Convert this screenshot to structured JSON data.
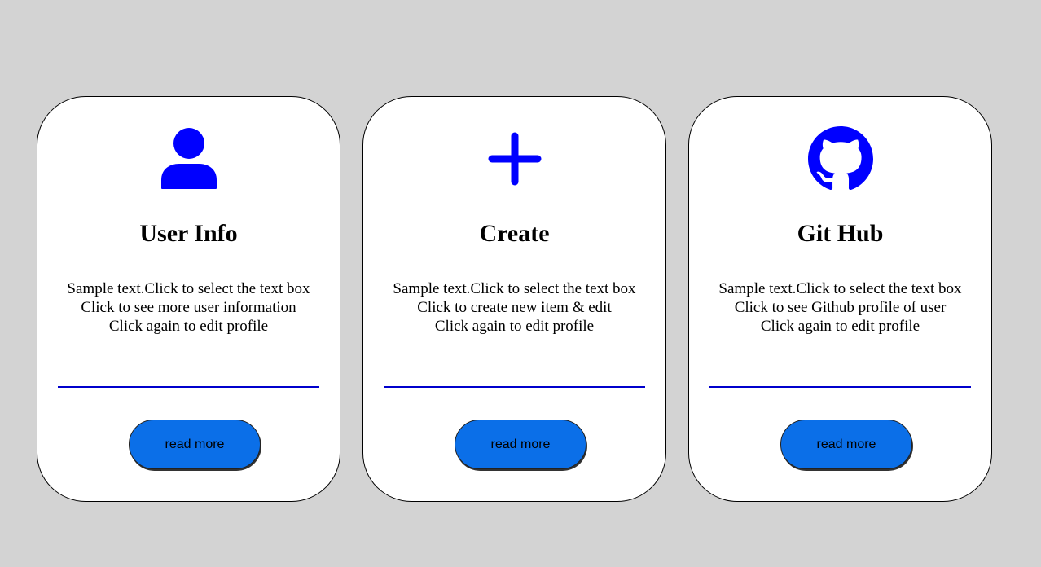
{
  "colors": {
    "background": "#d3d3d3",
    "card": "#ffffff",
    "icon": "#0000ff",
    "divider": "#0000cc",
    "button": "#0b6fe8"
  },
  "cards": [
    {
      "icon": "user-icon",
      "title": "User Info",
      "lines": [
        "Sample text.Click to select the text box",
        "Click to see more user information",
        "Click again to edit profile"
      ],
      "button": "read more"
    },
    {
      "icon": "plus-icon",
      "title": "Create",
      "lines": [
        "Sample text.Click to select the text box",
        "Click to create new item & edit",
        "Click again to edit profile"
      ],
      "button": "read more"
    },
    {
      "icon": "github-icon",
      "title": "Git Hub",
      "lines": [
        "Sample text.Click to select the text box",
        "Click to see Github profile of user",
        "Click again to edit profile"
      ],
      "button": "read more"
    }
  ]
}
